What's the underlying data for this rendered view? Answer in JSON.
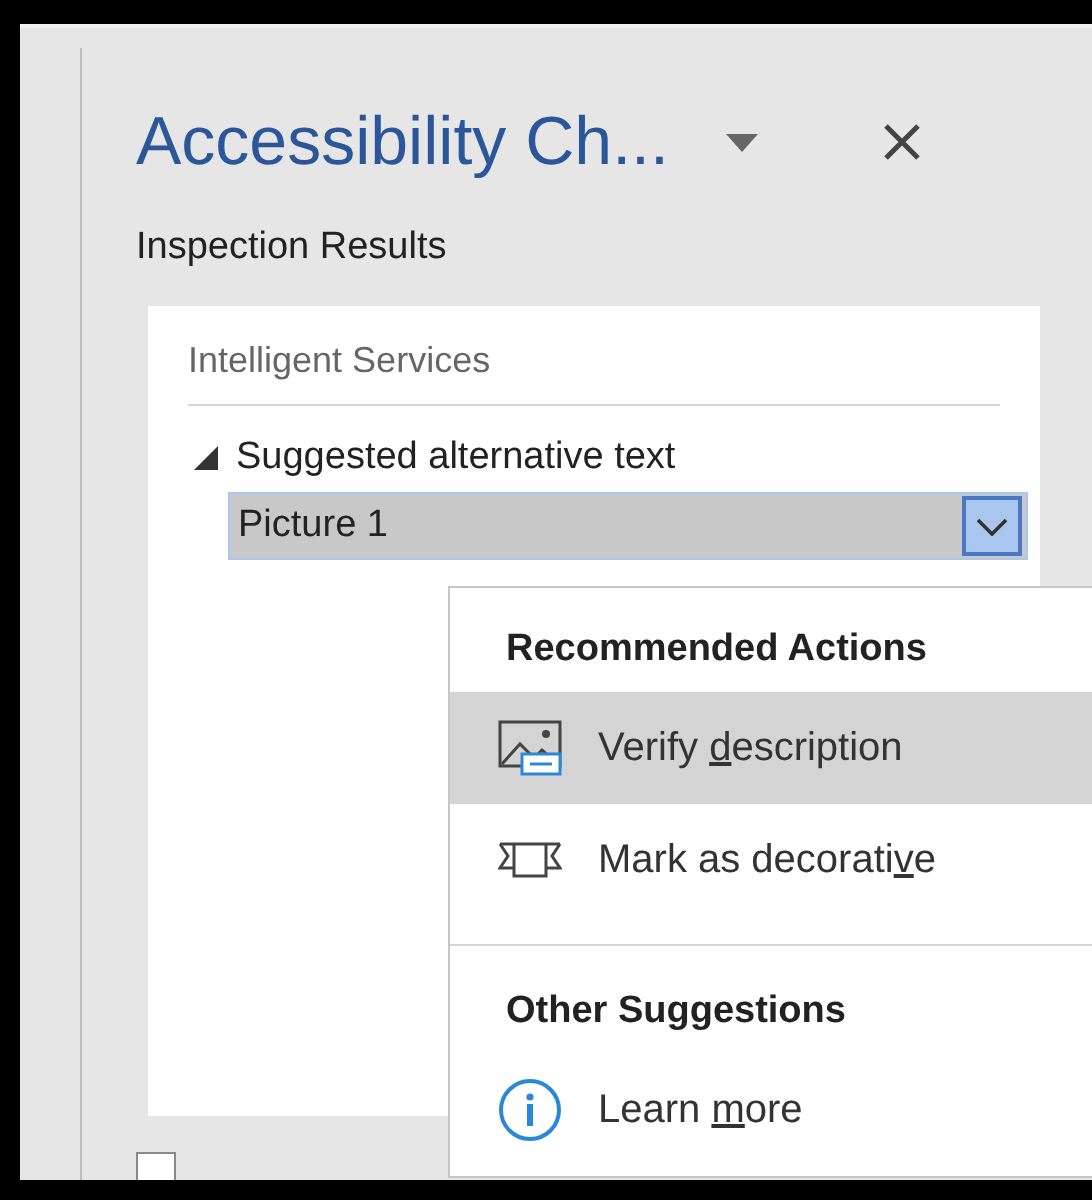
{
  "pane": {
    "title": "Accessibility Ch...",
    "section_label": "Inspection Results"
  },
  "results": {
    "group_header": "Intelligent Services",
    "tree": [
      {
        "label": "Suggested alternative text",
        "expanded": true,
        "children": [
          {
            "label": "Picture 1",
            "selected": true
          }
        ]
      }
    ]
  },
  "menu": {
    "sections": [
      {
        "heading": "Recommended Actions",
        "items": [
          {
            "kind": "verify",
            "before": "Verify ",
            "key": "d",
            "after": "escription",
            "selected": true
          },
          {
            "kind": "decorative",
            "before": "Mark as decorati",
            "key": "v",
            "after": "e",
            "selected": false
          }
        ]
      },
      {
        "heading": "Other Suggestions",
        "items": [
          {
            "kind": "info",
            "before": "Learn ",
            "key": "m",
            "after": "ore",
            "selected": false
          }
        ]
      }
    ]
  },
  "footer": {
    "checkbox": {
      "checked": false
    }
  }
}
